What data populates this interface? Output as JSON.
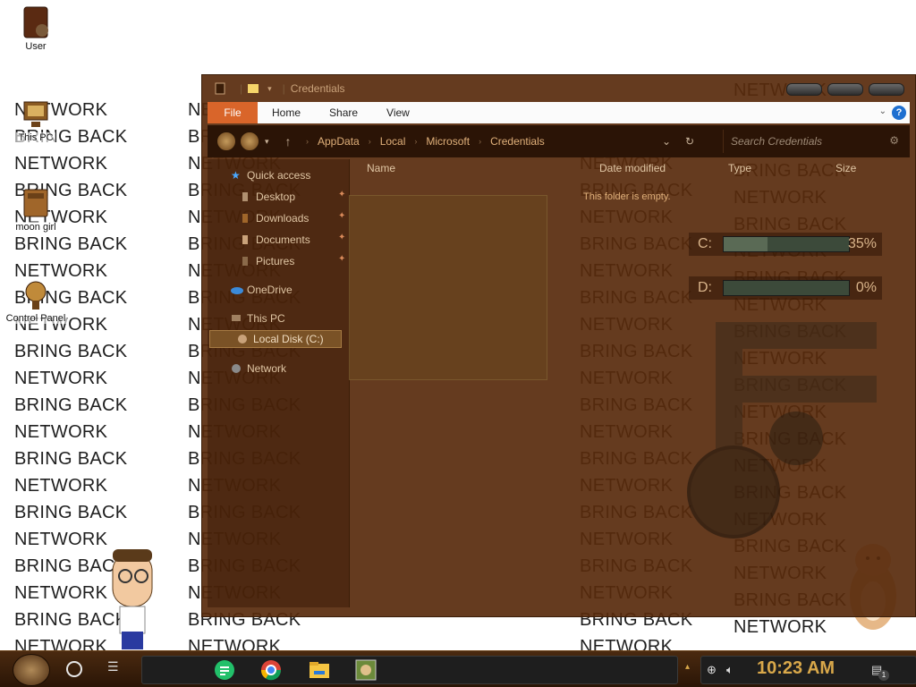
{
  "wallpaper": {
    "lines": [
      "NETWORK",
      "BRING BACK",
      "NETWORK",
      "BRING BACK",
      "NETWORK",
      "BRING BACK",
      "NETWORK",
      "BRING BACK",
      "NETWORK",
      "BRING BACK",
      "NETWORK",
      "BRING BACK",
      "NETWORK",
      "BRING BACK",
      "NETWORK",
      "BRING BACK",
      "NETWORK",
      "BRING BACK",
      "NETWORK",
      "BRING BACK",
      "NETWORK"
    ]
  },
  "desktop_icons": [
    {
      "label": "User",
      "icon": "user-folder-icon"
    },
    {
      "label": "This PC",
      "icon": "computer-icon"
    },
    {
      "label": "moon girl",
      "icon": "folder-icon"
    },
    {
      "label": "Control Panel",
      "icon": "control-panel-icon"
    }
  ],
  "window": {
    "title": "Credentials",
    "ribbon_tabs": [
      "File",
      "Home",
      "Share",
      "View"
    ],
    "help": "?",
    "breadcrumbs": [
      "AppData",
      "Local",
      "Microsoft",
      "Credentials"
    ],
    "search_placeholder": "Search Credentials",
    "columns": [
      "Name",
      "Date modified",
      "Type",
      "Size"
    ],
    "empty_message": "This folder is empty.",
    "sidebar": [
      {
        "label": "Quick access",
        "icon": "star-icon"
      },
      {
        "label": "Desktop",
        "icon": "desktop-icon",
        "pinned": true
      },
      {
        "label": "Downloads",
        "icon": "downloads-icon",
        "pinned": true
      },
      {
        "label": "Documents",
        "icon": "documents-icon",
        "pinned": true
      },
      {
        "label": "Pictures",
        "icon": "pictures-icon",
        "pinned": true
      },
      {
        "label": "OneDrive",
        "icon": "onedrive-icon"
      },
      {
        "label": "This PC",
        "icon": "computer-icon"
      },
      {
        "label": "Local Disk (C:)",
        "icon": "disk-icon",
        "selected": true
      },
      {
        "label": "Network",
        "icon": "network-icon"
      }
    ]
  },
  "drive_meters": [
    {
      "label": "C:",
      "percent_label": "35%",
      "percent": 35
    },
    {
      "label": "D:",
      "percent_label": "0%",
      "percent": 0
    }
  ],
  "taskbar": {
    "apps": [
      "sheets-icon",
      "chrome-icon",
      "file-explorer-icon",
      "image-app-icon"
    ],
    "clock": "10:23 AM",
    "notification_count": "1"
  },
  "colors": {
    "accent": "#d9652a",
    "window_bg": "#582a0c",
    "clock": "#d9a84a"
  }
}
